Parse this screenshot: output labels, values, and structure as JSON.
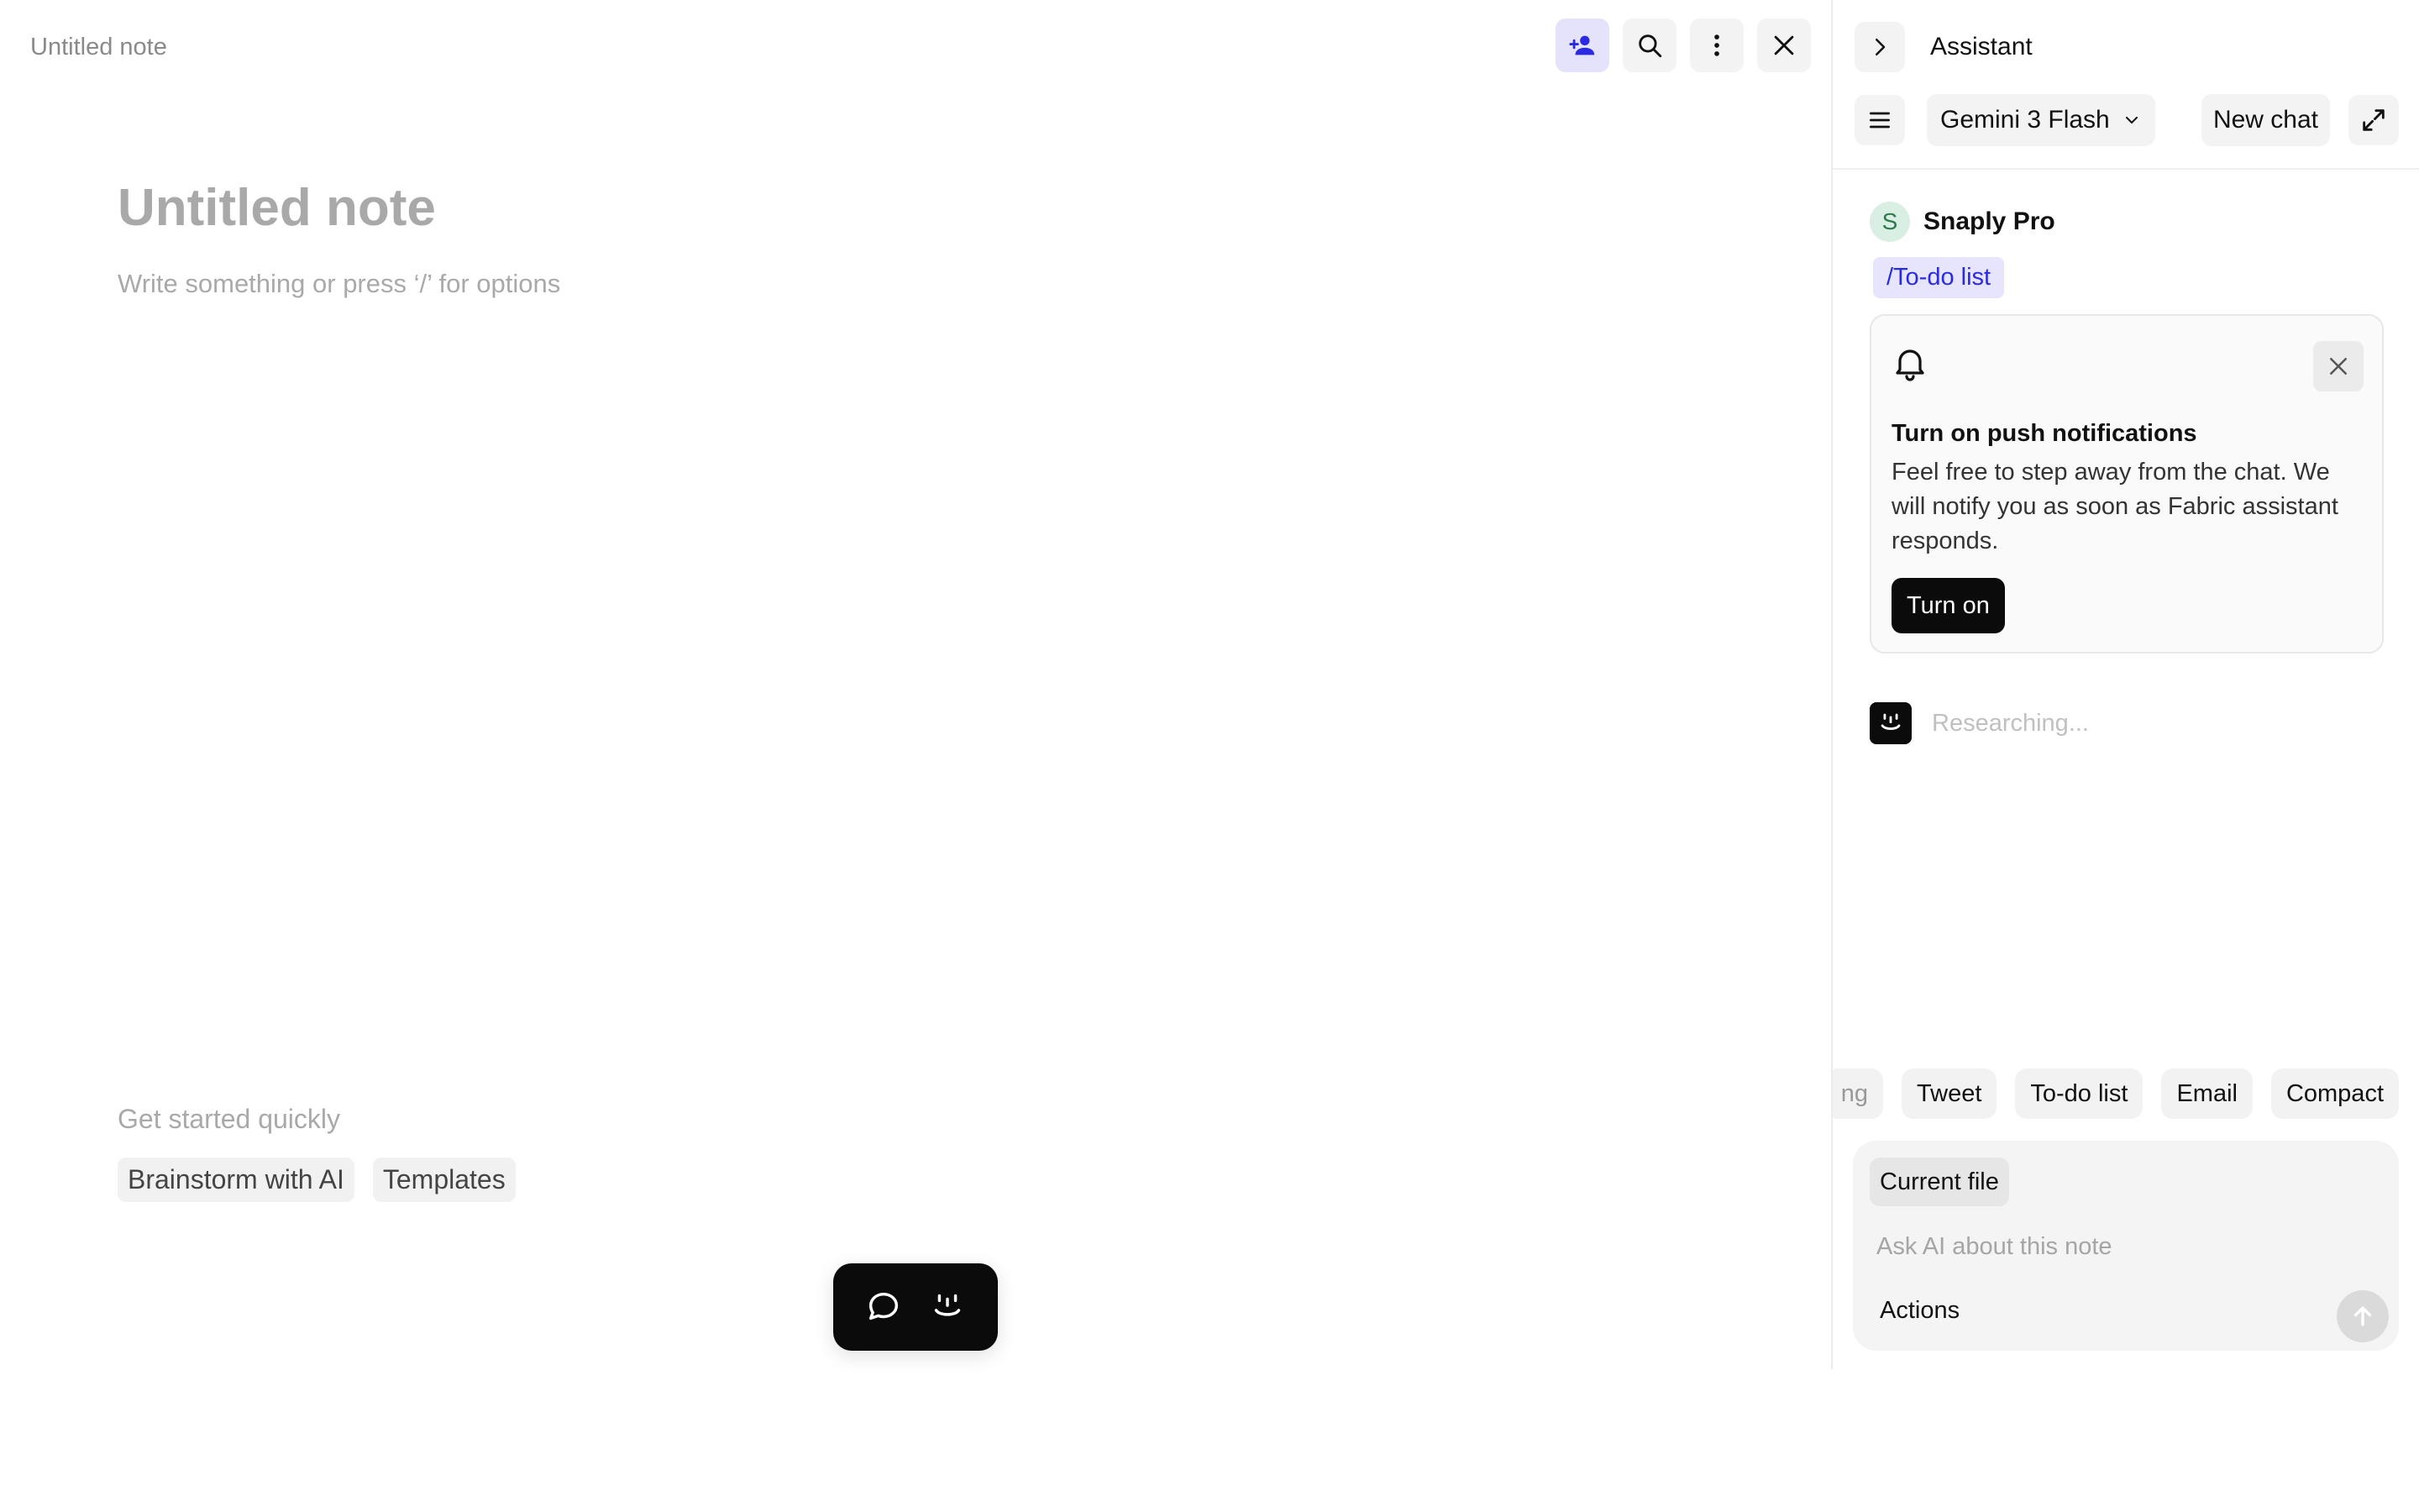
{
  "editor": {
    "tab_title": "Untitled note",
    "note_title": "Untitled note",
    "note_placeholder": "Write something or press ‘/’ for options",
    "get_started_label": "Get started quickly",
    "quick_actions": [
      "Brainstorm with AI",
      "Templates"
    ],
    "toolbar_icons": [
      "share-person-icon",
      "search-icon",
      "more-vertical-icon",
      "close-icon"
    ],
    "fab_icons": [
      "chat-bubble-icon",
      "assistant-face-icon"
    ]
  },
  "assistant": {
    "title": "Assistant",
    "model": "Gemini 3 Flash",
    "new_chat_label": "New chat",
    "user_initial": "S",
    "user_name": "Snaply Pro",
    "command_tag": "/To-do list",
    "notification": {
      "title": "Turn on push notifications",
      "body": "Feel free to step away from the chat. We will notify you as soon as Fabric assistant responds.",
      "button": "Turn on"
    },
    "status_text": "Researching...",
    "suggestions": [
      "ng",
      "Tweet",
      "To-do list",
      "Email",
      "Compact"
    ],
    "composer": {
      "context_chip": "Current file",
      "placeholder": "Ask AI about this note",
      "actions_label": "Actions"
    }
  },
  "colors": {
    "accent": "#2a2ae2",
    "accent_bg": "#e5e2fb",
    "dark": "#0b0b0b",
    "muted_text": "#a9a9a9"
  }
}
